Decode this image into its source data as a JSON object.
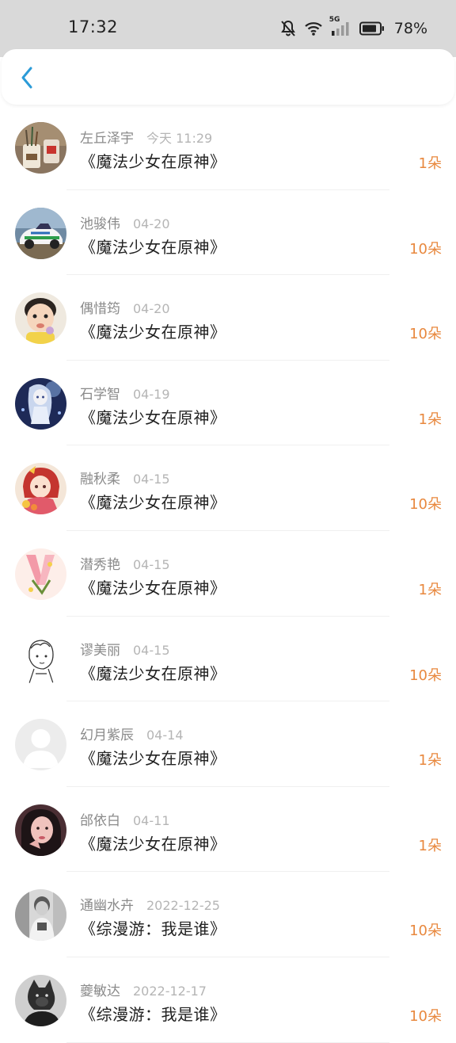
{
  "status_bar": {
    "time": "17:32",
    "signal_label": "5G",
    "battery": "78%"
  },
  "nav": {
    "back_icon": "chevron-left-icon",
    "accent": "#2b9bd8"
  },
  "colors": {
    "count": "#e8883e",
    "name": "#8a8a8a",
    "date": "#b5b5b5",
    "title": "#222222"
  },
  "rows": [
    {
      "name": "左丘泽宇",
      "date": "今天 11:29",
      "title": "《魔法少女在原神》",
      "count": "1朵",
      "avatar": "pens-cup"
    },
    {
      "name": "池骏伟",
      "date": "04-20",
      "title": "《魔法少女在原神》",
      "count": "10朵",
      "avatar": "rally-car"
    },
    {
      "name": "偶惜筠",
      "date": "04-20",
      "title": "《魔法少女在原神》",
      "count": "10朵",
      "avatar": "child"
    },
    {
      "name": "石学智",
      "date": "04-19",
      "title": "《魔法少女在原神》",
      "count": "1朵",
      "avatar": "anime-blue"
    },
    {
      "name": "融秋柔",
      "date": "04-15",
      "title": "《魔法少女在原神》",
      "count": "10朵",
      "avatar": "anime-red"
    },
    {
      "name": "潜秀艳",
      "date": "04-15",
      "title": "《魔法少女在原神》",
      "count": "1朵",
      "avatar": "pink-letter"
    },
    {
      "name": "谬美丽",
      "date": "04-15",
      "title": "《魔法少女在原神》",
      "count": "10朵",
      "avatar": "sketch"
    },
    {
      "name": "幻月紫辰",
      "date": "04-14",
      "title": "《魔法少女在原神》",
      "count": "1朵",
      "avatar": "default-user"
    },
    {
      "name": "邰依白",
      "date": "04-11",
      "title": "《魔法少女在原神》",
      "count": "1朵",
      "avatar": "girl-photo"
    },
    {
      "name": "通幽水卉",
      "date": "2022-12-25",
      "title": "《综漫游：我是谁》",
      "count": "10朵",
      "avatar": "bw-photo"
    },
    {
      "name": "夔敏达",
      "date": "2022-12-17",
      "title": "《综漫游：我是谁》",
      "count": "10朵",
      "avatar": "wolf-mask"
    }
  ]
}
